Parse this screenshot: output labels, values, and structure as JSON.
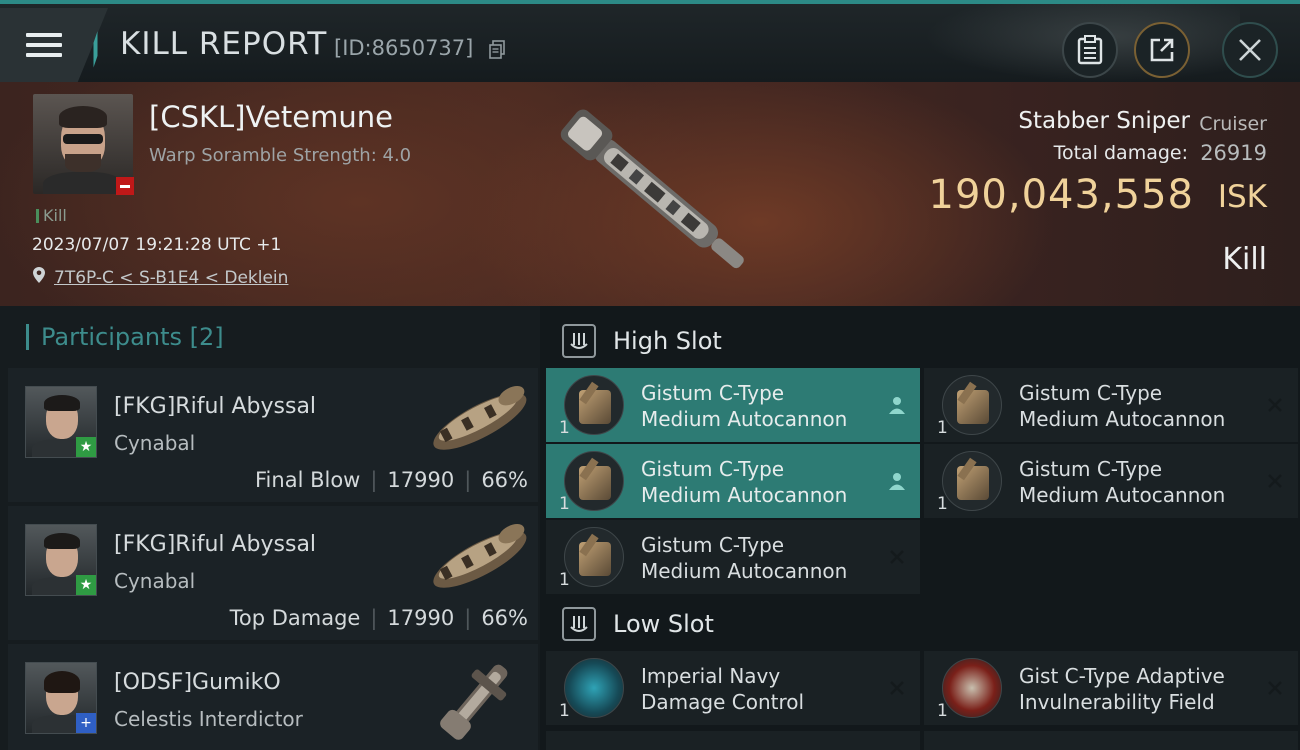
{
  "header": {
    "title": "KILL REPORT",
    "report_id": "[ID:8650737]"
  },
  "victim": {
    "name": "[CSKL]Vetemune",
    "subtitle": "Warp Soramble Strength: 4.0",
    "kill_tag": "Kill",
    "time": "2023/07/07 19:21:28 UTC +1",
    "location": "7T6P-C < S-B1E4 < Deklein",
    "ship_name": "Stabber Sniper",
    "ship_class": "Cruiser",
    "total_damage_label": "Total damage:",
    "total_damage": "26919",
    "isk_value": "190,043,558",
    "isk_unit": "ISK",
    "result": "Kill"
  },
  "participants": {
    "heading": "Participants [2]",
    "rows": [
      {
        "name": "[FKG]Riful Abyssal",
        "ship": "Cynabal",
        "role": "Final Blow",
        "damage": "17990",
        "percent": "66%",
        "badge": "★"
      },
      {
        "name": "[FKG]Riful Abyssal",
        "ship": "Cynabal",
        "role": "Top Damage",
        "damage": "17990",
        "percent": "66%",
        "badge": "★"
      },
      {
        "name": "[ODSF]GumikO",
        "ship": "Celestis Interdictor",
        "badge": "+"
      }
    ]
  },
  "fitting": {
    "high_slot_label": "High Slot",
    "low_slot_label": "Low Slot",
    "high": [
      {
        "qty": "1",
        "line1": "Gistum C-Type",
        "line2": "Medium Autocannon",
        "highlight": true
      },
      {
        "qty": "1",
        "line1": "Gistum C-Type",
        "line2": "Medium Autocannon",
        "highlight": false
      },
      {
        "qty": "1",
        "line1": "Gistum C-Type",
        "line2": "Medium Autocannon",
        "highlight": true
      },
      {
        "qty": "1",
        "line1": "Gistum C-Type",
        "line2": "Medium Autocannon",
        "highlight": false
      },
      {
        "qty": "1",
        "line1": "Gistum C-Type",
        "line2": "Medium Autocannon",
        "highlight": false
      }
    ],
    "low": [
      {
        "qty": "1",
        "line1": "Imperial Navy",
        "line2": "Damage Control"
      },
      {
        "qty": "1",
        "line1": "Gist C-Type Adaptive",
        "line2": "Invulnerability Field"
      }
    ]
  },
  "colors": {
    "accent": "#2c8a86",
    "isk": "#f0d29a",
    "highlight_row": "#2d7b74",
    "victim_badge": "#c01818"
  },
  "icons": {
    "menu": "hamburger-icon",
    "copy": "copy-icon",
    "clipboard": "clipboard-icon",
    "share": "share-icon",
    "close": "close-icon",
    "location": "location-pin-icon"
  }
}
